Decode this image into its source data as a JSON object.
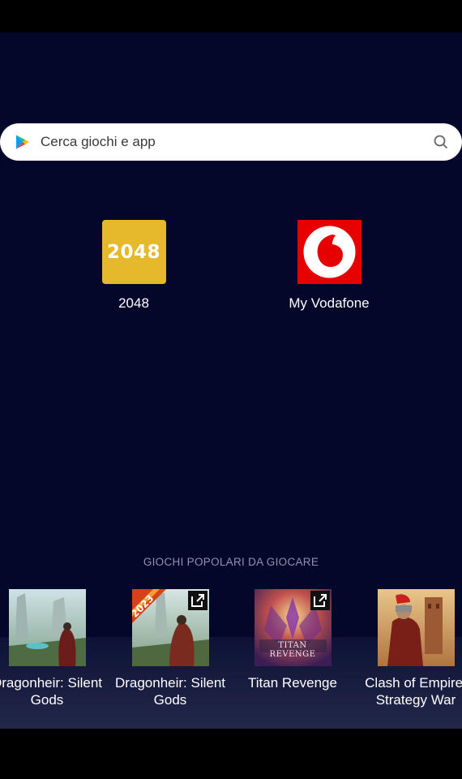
{
  "search": {
    "placeholder": "Cerca giochi e app"
  },
  "apps": [
    {
      "label": "2048",
      "icon_text": "2048",
      "icon": "2048-icon"
    },
    {
      "label": "My Vodafone",
      "icon": "vodafone-icon"
    }
  ],
  "popular": {
    "title": "GIOCHI POPOLARI DA GIOCARE",
    "games": [
      {
        "title": "Dragonheir: Silent Gods",
        "external": false
      },
      {
        "title": "Dragonheir: Silent Gods",
        "badge": "2023",
        "external": true
      },
      {
        "title": "Titan Revenge",
        "logo_text": "TITAN REVENGE",
        "external": true
      },
      {
        "title": "Clash of Empire: Strategy War",
        "external": false
      }
    ]
  },
  "colors": {
    "background": "#03072a",
    "vodafone_red": "#e60000",
    "tile_2048": "#e6b82c"
  }
}
